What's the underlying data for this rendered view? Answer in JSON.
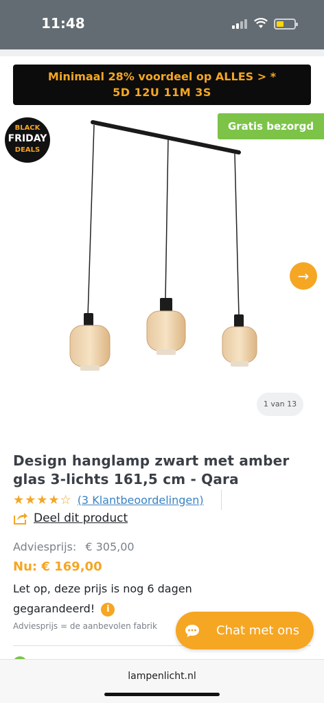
{
  "status": {
    "time": "11:48"
  },
  "promo": {
    "line1": "Minimaal 28% voordeel op ALLES > *",
    "line2": "5D 12U 11M 3S"
  },
  "badge": {
    "line1": "BLACK",
    "line2": "FRIDAY",
    "line3": "DEALS"
  },
  "shipping_badge": "Gratis bezorgd",
  "gallery": {
    "counter": "1 van 13",
    "next_icon": "arrow-right-icon"
  },
  "product": {
    "title": "Design hanglamp zwart met amber glas 3-lichts 161,5 cm - Qara",
    "rating": {
      "stars": "★★★★☆",
      "value": 4,
      "max": 5,
      "reviews_label": "(3 Klantbeoordelingen)"
    },
    "share_label": "Deel dit product",
    "advice_label": "Adviesprijs:",
    "advice_price": "€ 305,00",
    "now_price": "Nu: € 169,00",
    "note": "Let op, deze prijs is nog 6 dagen gegarandeerd!",
    "info_glyph": "i",
    "sub_note": "Adviesprijs = de aanbevolen fabrik"
  },
  "chat": {
    "label": "Chat met ons"
  },
  "browser": {
    "url": "lampenlicht.nl"
  },
  "colors": {
    "accent": "#f5a623",
    "green": "#7cc348",
    "promo_bg": "#0c0c0c",
    "status_bg": "#636c72"
  }
}
